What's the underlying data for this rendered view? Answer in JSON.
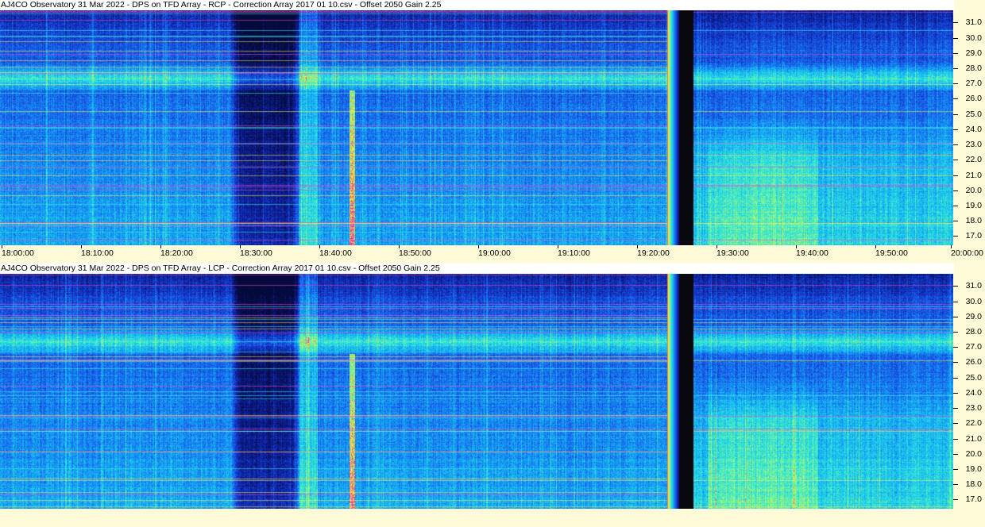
{
  "chart_data": [
    {
      "type": "heatmap",
      "title": "AJ4CO Observatory 31 Mar 2022  -  DPS on TFD Array  -  RCP  -  Correction Array 2017 01 10.csv  -  Offset 2050  Gain 2.25",
      "x_ticks": [
        "18:00:00",
        "18:10:00",
        "18:20:00",
        "18:30:00",
        "18:40:00",
        "18:50:00",
        "19:00:00",
        "19:10:00",
        "19:20:00",
        "19:30:00",
        "19:40:00",
        "19:50:00",
        "20:00:00"
      ],
      "y_ticks": [
        "31.0",
        "30.0",
        "29.0",
        "28.0",
        "27.0",
        "26.0",
        "25.0",
        "24.0",
        "23.0",
        "22.0",
        "21.0",
        "20.0",
        "19.0",
        "18.0",
        "17.0"
      ],
      "xlim": [
        "18:00:00",
        "20:00:00"
      ],
      "ylim": [
        16.4,
        31.8
      ],
      "ylabel": "",
      "xlabel": ""
    },
    {
      "type": "heatmap",
      "title": "AJ4CO Observatory 31 Mar 2022  -  DPS on TFD Array  -  LCP  -  Correction Array 2017 01 10.csv  -  Offset 2050  Gain 2.25",
      "x_ticks": [],
      "y_ticks": [
        "31.0",
        "30.0",
        "29.0",
        "28.0",
        "27.0",
        "26.0",
        "25.0",
        "24.0",
        "23.0",
        "22.0",
        "21.0",
        "20.0",
        "19.0",
        "18.0",
        "17.0"
      ],
      "xlim": [
        "18:00:00",
        "20:00:00"
      ],
      "ylim": [
        16.4,
        31.8
      ],
      "ylabel": "",
      "xlabel": ""
    }
  ]
}
